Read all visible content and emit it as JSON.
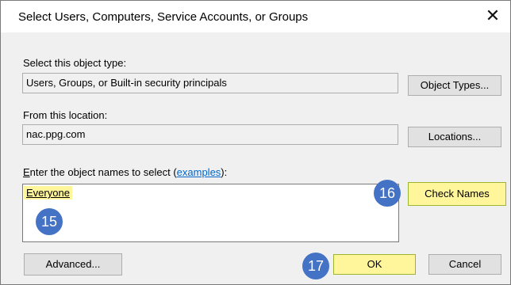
{
  "window": {
    "title": "Select Users, Computers, Service Accounts, or Groups",
    "close_glyph": "✕"
  },
  "object_type": {
    "label": "Select this object type:",
    "value": "Users, Groups, or Built-in security principals",
    "button": "Object Types..."
  },
  "location": {
    "label": "From this location:",
    "value": "nac.ppg.com",
    "button": "Locations..."
  },
  "names": {
    "label_accel": "E",
    "label_rest": "nter the object names to select (",
    "label_link": "examples",
    "label_end": "):",
    "value": "Everyone",
    "check_button": "Check Names"
  },
  "footer": {
    "advanced_button": "Advanced...",
    "ok_button": "OK",
    "cancel_button": "Cancel"
  },
  "callouts": {
    "names_step": "15",
    "check_step": "16",
    "ok_step": "17"
  },
  "colors": {
    "highlight": "#fff59a",
    "callout": "#4472c4",
    "link": "#0066cc"
  }
}
